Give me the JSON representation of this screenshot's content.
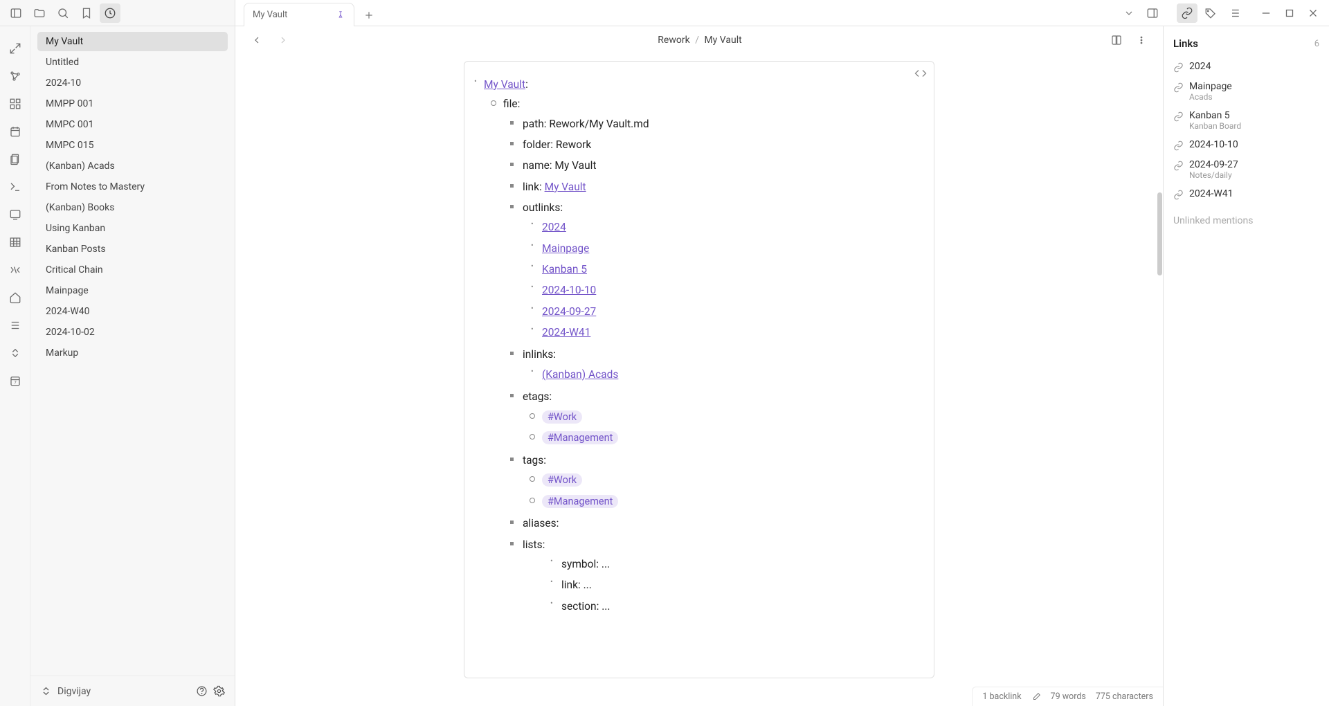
{
  "tab": {
    "label": "My Vault"
  },
  "sidebar": {
    "items": [
      "My Vault",
      "Untitled",
      "2024-10",
      "MMPP 001",
      "MMPC 001",
      "MMPC 015",
      "(Kanban) Acads",
      "From Notes to Mastery",
      "(Kanban) Books",
      "Using Kanban",
      "Kanban Posts",
      "Critical Chain",
      "Mainpage",
      "2024-W40",
      "2024-10-02",
      "Markup"
    ],
    "user": "Digvijay"
  },
  "breadcrumb": {
    "folder": "Rework",
    "file": "My Vault"
  },
  "content": {
    "root_link": "My Vault",
    "file_label": "file:",
    "path": {
      "k": "path:",
      "v": "Rework/My Vault.md"
    },
    "folder": {
      "k": "folder:",
      "v": "Rework"
    },
    "name": {
      "k": "name:",
      "v": "My Vault"
    },
    "link_label": "link:",
    "link_target": "My Vault",
    "outlinks_label": "outlinks:",
    "outlinks": [
      "2024",
      "Mainpage",
      "Kanban 5",
      "2024-10-10",
      "2024-09-27",
      "2024-W41"
    ],
    "inlinks_label": "inlinks:",
    "inlinks": [
      "(Kanban) Acads"
    ],
    "etags_label": "etags:",
    "etags": [
      "#Work",
      "#Management"
    ],
    "tags_label": "tags:",
    "tags": [
      "#Work",
      "#Management"
    ],
    "aliases_label": "aliases:",
    "lists_label": "lists:",
    "lists": {
      "symbol": {
        "k": "symbol:",
        "v": "..."
      },
      "link": {
        "k": "link:",
        "v": "..."
      },
      "section": {
        "k": "section:",
        "v": "..."
      }
    }
  },
  "right_panel": {
    "title": "Links",
    "count": "6",
    "links": [
      {
        "title": "2024",
        "sub": ""
      },
      {
        "title": "Mainpage",
        "sub": "Acads"
      },
      {
        "title": "Kanban 5",
        "sub": "Kanban Board"
      },
      {
        "title": "2024-10-10",
        "sub": ""
      },
      {
        "title": "2024-09-27",
        "sub": "Notes/daily"
      },
      {
        "title": "2024-W41",
        "sub": ""
      }
    ],
    "unlinked": "Unlinked mentions"
  },
  "status": {
    "backlink": "1 backlink",
    "words": "79 words",
    "chars": "775 characters"
  }
}
